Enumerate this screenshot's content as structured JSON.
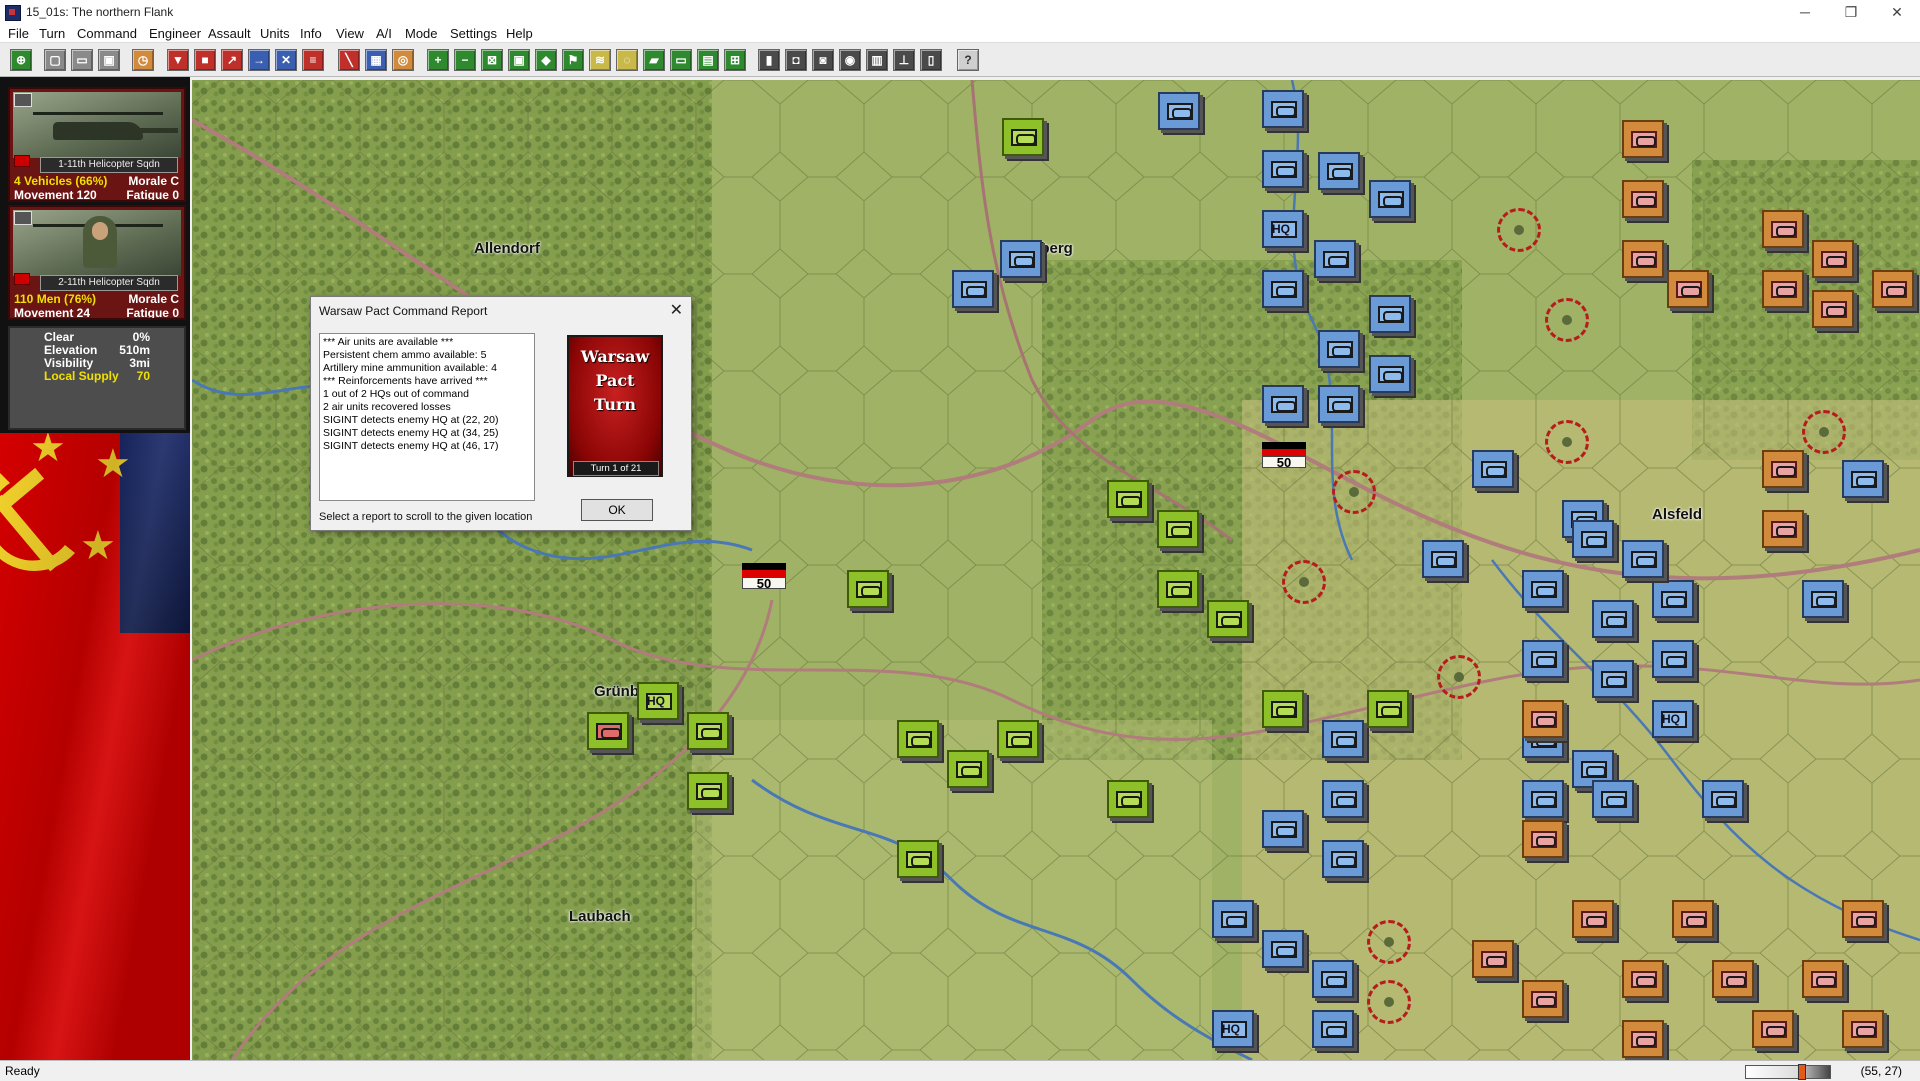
{
  "window": {
    "title": "15_01s: The northern Flank",
    "minimize": "─",
    "restore": "❐",
    "close": "✕"
  },
  "menu": [
    "File",
    "Turn",
    "Command",
    "Engineer",
    "Assault",
    "Units",
    "Info",
    "View",
    "A/I",
    "Mode",
    "Settings",
    "Help"
  ],
  "units": [
    {
      "name": "1-11th Helicopter Sqdn",
      "strength": "4 Vehicles (66%)",
      "morale": "Morale C",
      "movement": "Movement 120",
      "fatigue": "Fatigue 0"
    },
    {
      "name": "2-11th Helicopter Sqdn",
      "strength": "110 Men (76%)",
      "morale": "Morale C",
      "movement": "Movement 24",
      "fatigue": "Fatigue 0"
    }
  ],
  "terrain": {
    "weather_label": "Clear",
    "weather_value": "0%",
    "elevation_label": "Elevation",
    "elevation_value": "510m",
    "visibility_label": "Visibility",
    "visibility_value": "3mi",
    "supply_label": "Local Supply",
    "supply_value": "70"
  },
  "map": {
    "towns": [
      "Allendorf",
      "Homberg",
      "Grünberg",
      "Alsfeld",
      "Laubach"
    ],
    "stack_value": "50"
  },
  "dialog": {
    "title": "Warsaw Pact Command Report",
    "close": "✕",
    "lines": [
      "*** Air units are available ***",
      "Persistent chem ammo available: 5",
      "Artillery mine ammunition available: 4",
      "*** Reinforcements have arrived ***",
      "1 out of 2 HQs out of command",
      "2 air units recovered losses",
      "SIGINT detects enemy HQ at (22, 20)",
      "SIGINT detects enemy HQ at (34, 25)",
      "SIGINT detects enemy HQ at (46, 17)"
    ],
    "badge_text": "Warsaw\nPact\nTurn",
    "turn_text": "Turn  1  of  21",
    "hint": "Select a report to scroll to the given location",
    "ok": "OK"
  },
  "hq_label": "HQ",
  "status": {
    "text": "Ready",
    "coords": "(55, 27)"
  },
  "colors": {
    "blue_counter": "#6a9bd6",
    "orange_counter": "#d28a3c",
    "green_counter": "#8ec02a",
    "soviet_red": "#d40000"
  }
}
